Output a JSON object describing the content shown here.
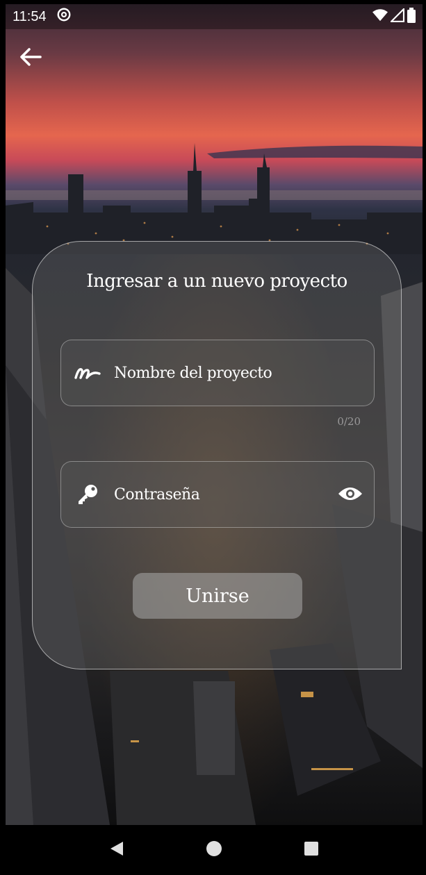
{
  "status_bar": {
    "time": "11:54",
    "icons": [
      "at-sign-icon",
      "wifi-icon",
      "signal-icon",
      "battery-icon"
    ]
  },
  "header": {
    "back_icon": "arrow-left-icon"
  },
  "card": {
    "title": "Ingresar a un nuevo proyecto",
    "name_field": {
      "icon": "signature-icon",
      "placeholder": "Nombre del proyecto",
      "counter": "0/20"
    },
    "password_field": {
      "icon": "key-icon",
      "placeholder": "Contraseña",
      "toggle_icon": "eye-icon"
    },
    "join_button_label": "Unirse"
  },
  "nav_bar": {
    "icons": [
      "back-triangle-icon",
      "home-circle-icon",
      "recents-square-icon"
    ]
  },
  "colors": {
    "card_border": "#ffffff",
    "text": "#ffffff",
    "nav_icons": "#e0e0e0"
  }
}
